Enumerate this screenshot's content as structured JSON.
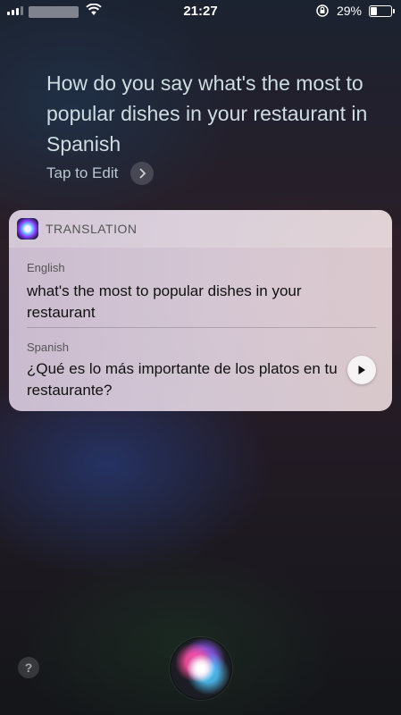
{
  "status_bar": {
    "time": "21:27",
    "battery_percent": "29%",
    "battery_level": 0.29,
    "icons": [
      "signal-icon",
      "wifi-icon",
      "orientation-lock-icon",
      "battery-icon"
    ]
  },
  "query": {
    "text": "How do you say what's the most to popular dishes in your restaurant in Spanish",
    "edit_label": "Tap to Edit"
  },
  "card": {
    "title": "TRANSLATION",
    "source": {
      "language": "English",
      "text": "what's the most to popular dishes in your restaurant"
    },
    "target": {
      "language": "Spanish",
      "text": "¿Qué es lo más importante de los platos en tu restaurante?"
    }
  },
  "help_label": "?",
  "colors": {
    "query_text": "#cfdde2",
    "card_bg": "#e2d6e0"
  }
}
